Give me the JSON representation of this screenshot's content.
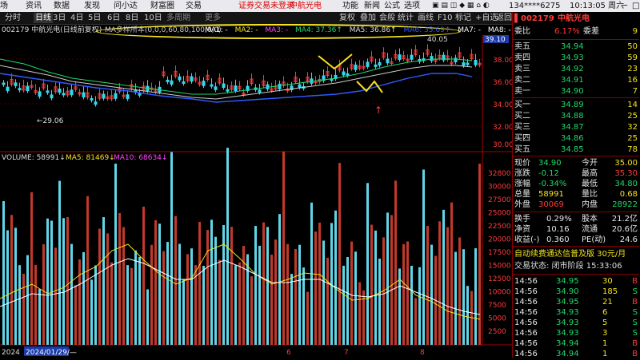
{
  "menubar": {
    "items": [
      "场",
      "资讯",
      "数据",
      "发现",
      "问小达",
      "财富圈",
      "交易"
    ],
    "alert": "证券交易未登录",
    "alert_stock": "中航光电",
    "right_items": [
      "功能",
      "新闻",
      "公式",
      "选项"
    ],
    "account": "134****6275",
    "clock": "10:13:05 周六"
  },
  "toolbar": {
    "periods": [
      "分时",
      "日线",
      "3日",
      "4日",
      "5日",
      "6日",
      "8日",
      "10日",
      "多周期",
      "更多"
    ],
    "active": "日线",
    "right_tools": [
      "复权",
      "叠加",
      "统计",
      "画线",
      "F10",
      "标记",
      "+自选",
      "返回"
    ]
  },
  "chart": {
    "title": "002179 中航光电(日线前复权)",
    "ma_params": "MA多样所本(0,0,0,60,80,100,0,0)",
    "ma_items": [
      {
        "label": "MA1: -",
        "color": "#ffffff"
      },
      {
        "label": "MA2: -",
        "color": "#f5e31f"
      },
      {
        "label": "MA3: -",
        "color": "#ff44ff"
      },
      {
        "label": "MA4: 37.36↑",
        "color": "#1fd96b"
      },
      {
        "label": "MA5: 36.86↑",
        "color": "#dddddd"
      },
      {
        "label": "MA6: 35.69↑",
        "color": "#2e5bff"
      },
      {
        "label": "MA7: -",
        "color": "#ffffff"
      },
      {
        "label": "MA8: -",
        "color": "#ffffff"
      }
    ],
    "price_axis": [
      "38.00",
      "36.00",
      "34.00",
      "32.00",
      "30.00"
    ],
    "price_tag": "39.10",
    "high_label": "40.05",
    "low_label": "←29.06",
    "volume_header": {
      "volume": "VOLUME: 58991↓",
      "ma5": "MA5: 81469↓",
      "ma10": "MA10: 68634↓"
    },
    "volume_axis": [
      "32800",
      "30000",
      "27500",
      "25000",
      "22500",
      "20000",
      "17500",
      "15000",
      "12500",
      "10000",
      "7500",
      "5000",
      "2500"
    ],
    "date_tag": "2024/01/29/—",
    "month_labels": [
      "2024",
      "6",
      "7",
      "8"
    ],
    "bottom_tabs": [
      "指标A",
      "指标B",
      "模板",
      "日内",
      "指南针",
      "MACD",
      "MA基本",
      "BBS",
      "KDJ"
    ]
  },
  "quote": {
    "code": "002179",
    "name": "中航光电",
    "weibi_label": "委比",
    "weibi": "6.17%",
    "weicha_label": "委差",
    "weicha": "9",
    "asks": [
      {
        "label": "卖五",
        "price": "34.94",
        "vol": "50"
      },
      {
        "label": "卖四",
        "price": "34.93",
        "vol": "59"
      },
      {
        "label": "卖三",
        "price": "34.92",
        "vol": "23"
      },
      {
        "label": "卖二",
        "price": "34.91",
        "vol": "16"
      },
      {
        "label": "卖一",
        "price": "34.90",
        "vol": "7"
      }
    ],
    "bids": [
      {
        "label": "买一",
        "price": "34.89",
        "vol": "14"
      },
      {
        "label": "买二",
        "price": "34.88",
        "vol": "25"
      },
      {
        "label": "买三",
        "price": "34.87",
        "vol": "32"
      },
      {
        "label": "买四",
        "price": "34.86",
        "vol": "25"
      },
      {
        "label": "买五",
        "price": "34.85",
        "vol": "78"
      }
    ],
    "stats": [
      {
        "l1": "现价",
        "v1": "34.90",
        "c1": "green",
        "l2": "今开",
        "v2": "35.00",
        "c2": "yellow"
      },
      {
        "l1": "涨跌",
        "v1": "-0.12",
        "c1": "green",
        "l2": "最高",
        "v2": "35.30",
        "c2": "red"
      },
      {
        "l1": "涨幅",
        "v1": "-0.34%",
        "c1": "green",
        "l2": "最低",
        "v2": "34.80",
        "c2": "green"
      },
      {
        "l1": "总量",
        "v1": "58991",
        "c1": "yellow",
        "l2": "量比",
        "v2": "0.68",
        "c2": "yellow"
      },
      {
        "l1": "外盘",
        "v1": "30069",
        "c1": "red",
        "l2": "内盘",
        "v2": "28922",
        "c2": "green"
      }
    ],
    "stats2": [
      {
        "l1": "换手",
        "v1": "0.29%",
        "l2": "股本",
        "v2": "21.2亿"
      },
      {
        "l1": "净资",
        "v1": "10.16",
        "l2": "流通",
        "v2": "20.6亿"
      },
      {
        "l1": "收益(-)",
        "v1": "0.360",
        "l2": "PE(动)",
        "v2": "24.6"
      }
    ],
    "promo": "自动续费通达信普及版 30元/月",
    "status": "交易状态: 闭市阶段 15:33:06",
    "ticks": [
      {
        "time": "14:56",
        "price": "34.95",
        "vol": "30",
        "side": "B"
      },
      {
        "time": "14:56",
        "price": "34.90",
        "vol": "185",
        "side": "S"
      },
      {
        "time": "14:56",
        "price": "34.95",
        "vol": "21",
        "side": "B"
      },
      {
        "time": "14:56",
        "price": "34.93",
        "vol": "6",
        "side": "S"
      },
      {
        "time": "14:56",
        "price": "34.93",
        "vol": "5",
        "side": "S"
      },
      {
        "time": "14:56",
        "price": "34.93",
        "vol": "3",
        "side": "S"
      },
      {
        "time": "14:56",
        "price": "34.94",
        "vol": "1",
        "side": "B"
      },
      {
        "time": "14:56",
        "price": "34.94",
        "vol": "1",
        "side": "B"
      }
    ]
  }
}
